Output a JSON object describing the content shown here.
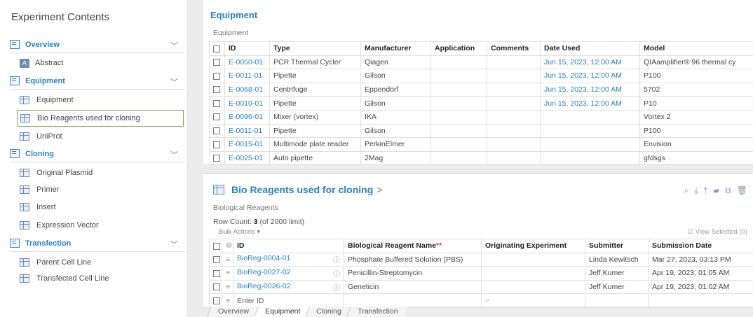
{
  "sidebar": {
    "title": "Experiment Contents",
    "overview": "Overview",
    "abstract": "Abstract",
    "equipment": "Equipment",
    "equipment_item": "Equipment",
    "bio_reagents": "Bio Reagents used for cloning",
    "uniprot": "UniProt",
    "cloning": "Cloning",
    "original_plasmid": "Original Plasmid",
    "primer": "Primer",
    "insert": "Insert",
    "expression_vector": "Expression Vector",
    "transfection": "Transfection",
    "parent_cell_line": "Parent Cell Line",
    "transfected_cell_line": "Transfected Cell Line"
  },
  "equipment": {
    "title": "Equipment",
    "subtitle": "Equipment",
    "headers": [
      "ID",
      "Type",
      "Manufacturer",
      "Application",
      "Comments",
      "Date Used",
      "Model"
    ],
    "rows": [
      {
        "id": "E-0050-01",
        "type": "PCR Thermal Cycler",
        "manufacturer": "Qiagen",
        "application": "",
        "comments": "",
        "date": "Jun 15, 2023, 12:00 AM",
        "model": "QIAamplifier® 96 thermal cy"
      },
      {
        "id": "E-0011-01",
        "type": "Pipette",
        "manufacturer": "Gilson",
        "application": "",
        "comments": "",
        "date": "Jun 15, 2023, 12:00 AM",
        "model": "P100"
      },
      {
        "id": "E-0068-01",
        "type": "Centrifuge",
        "manufacturer": "Eppendorf",
        "application": "",
        "comments": "",
        "date": "Jun 15, 2023, 12:00 AM",
        "model": "5702"
      },
      {
        "id": "E-0010-01",
        "type": "Pipette",
        "manufacturer": "Gilson",
        "application": "",
        "comments": "",
        "date": "Jun 15, 2023, 12:00 AM",
        "model": "P10"
      },
      {
        "id": "E-0096-01",
        "type": "Mixer (vortex)",
        "manufacturer": "IKA",
        "application": "",
        "comments": "",
        "date": "",
        "model": "Vortex 2"
      },
      {
        "id": "E-0011-01",
        "type": "Pipette",
        "manufacturer": "Gilson",
        "application": "",
        "comments": "",
        "date": "",
        "model": "P100"
      },
      {
        "id": "E-0015-01",
        "type": "Multimode plate reader",
        "manufacturer": "PerkinElmer",
        "application": "",
        "comments": "",
        "date": "",
        "model": "Envision"
      },
      {
        "id": "E-0025-01",
        "type": "Auto pipette",
        "manufacturer": "2Mag",
        "application": "",
        "comments": "",
        "date": "",
        "model": "gfdsgs"
      }
    ]
  },
  "bio": {
    "title": "Bio Reagents used for cloning",
    "arrow": ">",
    "subtitle": "Biological Reagents",
    "row_count_label": "Row Count:",
    "row_count": "3",
    "row_limit": "(of 2000 limit)",
    "bulk_actions": "Bulk Actions ▾",
    "view_selected": "☑ View Selected (0)",
    "headers": [
      "ID",
      "Biological Reagent Name",
      "Originating Experiment",
      "Submitter",
      "Submission Date"
    ],
    "required_mark": "**",
    "rows": [
      {
        "id": "BioReg-0004-01",
        "name": "Phosphate Buffered Solution (PBS)",
        "origin": "",
        "submitter": "Linda Kewitsch",
        "date": "Mar 27, 2023, 03:13 PM"
      },
      {
        "id": "BioReg-0027-02",
        "name": "Penicillin-Streptomycin",
        "origin": "",
        "submitter": "Jeff Kumer",
        "date": "Apr 19, 2023, 01:05 AM"
      },
      {
        "id": "BioReg-0026-02",
        "name": "Geneticin",
        "origin": "",
        "submitter": "Jeff Kumer",
        "date": "Apr 19, 2023, 01:02 AM"
      }
    ],
    "enter_id_placeholder": "Enter ID"
  },
  "tabs": [
    "Overview",
    "Equipment",
    "Cloning",
    "Transfection"
  ],
  "colors": {
    "accent": "#2a7fc1",
    "selected_border": "#6ab04c",
    "required": "#d9342b"
  }
}
